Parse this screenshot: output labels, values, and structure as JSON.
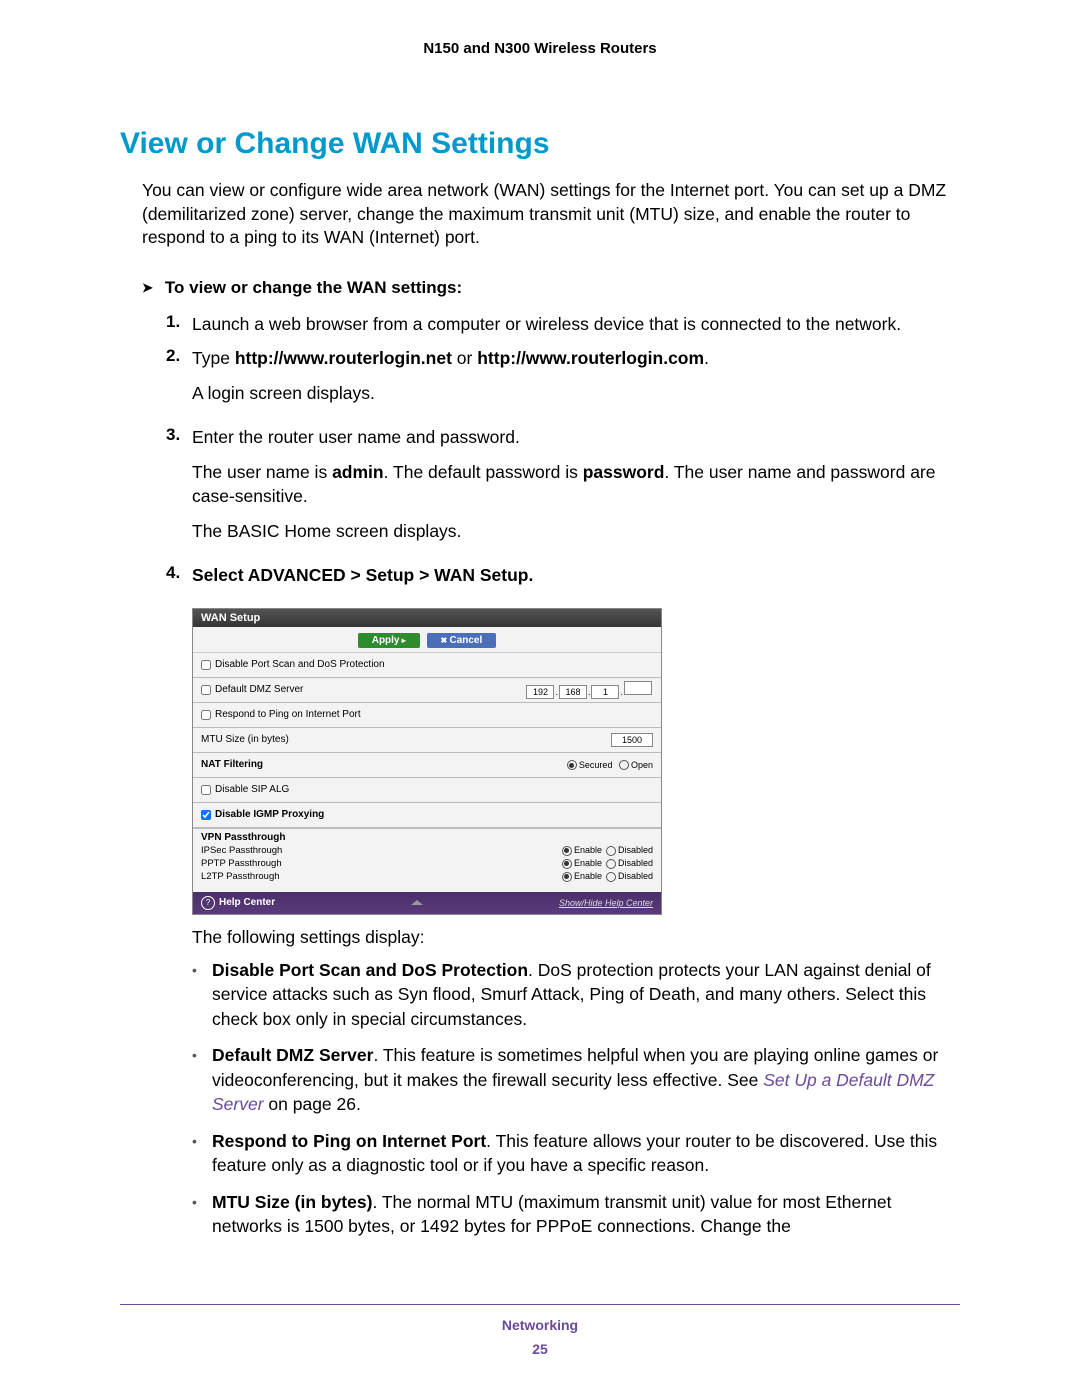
{
  "header": "N150 and N300 Wireless Routers",
  "heading": "View or Change WAN Settings",
  "intro": "You can view or configure wide area network (WAN) settings for the Internet port. You can set up a DMZ (demilitarized zone) server, change the maximum transmit unit (MTU) size, and enable the router to respond to a ping to its WAN (Internet) port.",
  "task_heading": "To view or change the WAN settings:",
  "steps": {
    "s1": "Launch a web browser from a computer or wireless device that is connected to the network.",
    "s2_pre": "Type ",
    "s2_b1": "http://www.routerlogin.net",
    "s2_mid": " or ",
    "s2_b2": "http://www.routerlogin.com",
    "s2_post": ".",
    "s2_note": "A login screen displays.",
    "s3_a": "Enter the router user name and password.",
    "s3_b_pre": "The user name is ",
    "s3_b_admin": "admin",
    "s3_b_mid": ". The default password is ",
    "s3_b_pwd": "password",
    "s3_b_post": ". The user name and password are case-sensitive.",
    "s3_c": "The BASIC Home screen displays.",
    "s4": "Select ADVANCED > Setup > WAN Setup."
  },
  "wan": {
    "title": "WAN Setup",
    "apply": "Apply",
    "cancel": "Cancel",
    "row_portscan": "Disable Port Scan and DoS Protection",
    "row_dmz": "Default DMZ Server",
    "ip": [
      "192",
      "168",
      "1",
      ""
    ],
    "row_ping": "Respond to Ping on Internet Port",
    "row_mtu": "MTU Size (in bytes)",
    "mtu_val": "1500",
    "row_nat": "NAT Filtering",
    "nat_secured": "Secured",
    "nat_open": "Open",
    "row_sip": "Disable SIP ALG",
    "row_igmp": "Disable IGMP Proxying",
    "vpn_hdr": "VPN Passthrough",
    "vpn_ipsec": "IPSec Passthrough",
    "vpn_pptp": "PPTP Passthrough",
    "vpn_l2tp": "L2TP Passthrough",
    "enable": "Enable",
    "disabled": "Disabled",
    "help": "Help Center",
    "help_link": "Show/Hide Help Center"
  },
  "after_shot": "The following settings display:",
  "bullets": {
    "b1_title": "Disable Port Scan and DoS Protection",
    "b1_text": ". DoS protection protects your LAN against denial of service attacks such as Syn flood, Smurf Attack, Ping of Death, and many others. Select this check box only in special circumstances.",
    "b2_title": "Default DMZ Server",
    "b2_text": ". This feature is sometimes helpful when you are playing online games or videoconferencing, but it makes the firewall security less effective. See ",
    "b2_link": "Set Up a Default DMZ Server",
    "b2_post": " on page 26.",
    "b3_title": "Respond to Ping on Internet Port",
    "b3_text": ". This feature allows your router to be discovered. Use this feature only as a diagnostic tool or if you have a specific reason.",
    "b4_title": "MTU Size (in bytes)",
    "b4_text": ". The normal MTU (maximum transmit unit) value for most Ethernet networks is 1500 bytes, or 1492 bytes for PPPoE connections. Change the"
  },
  "footer": {
    "section": "Networking",
    "page": "25"
  }
}
